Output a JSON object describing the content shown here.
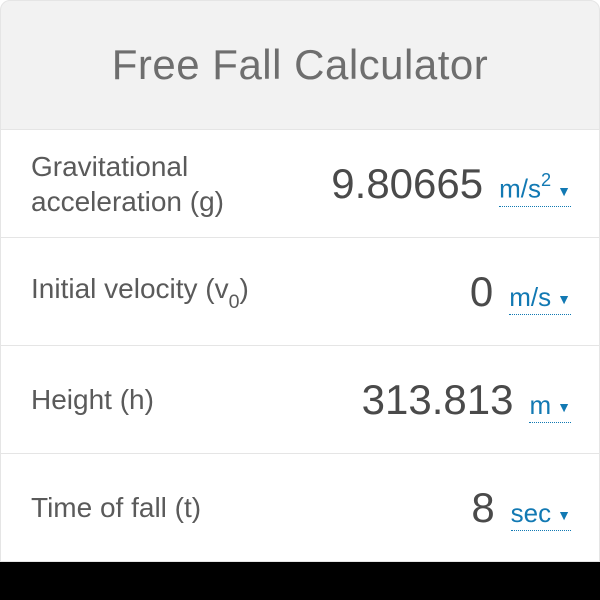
{
  "title": "Free Fall Calculator",
  "rows": [
    {
      "label_html": "Gravitational acceleration (g)",
      "value": "9.80665",
      "unit_html": "m/s<span class=\"sup\">2</span>"
    },
    {
      "label_html": "Initial velocity (v<span class=\"sub\">0</span>)",
      "value": "0",
      "unit_html": "m/s"
    },
    {
      "label_html": "Height (h)",
      "value": "313.813",
      "unit_html": "m"
    },
    {
      "label_html": "Time of fall (t)",
      "value": "8",
      "unit_html": "sec"
    }
  ]
}
